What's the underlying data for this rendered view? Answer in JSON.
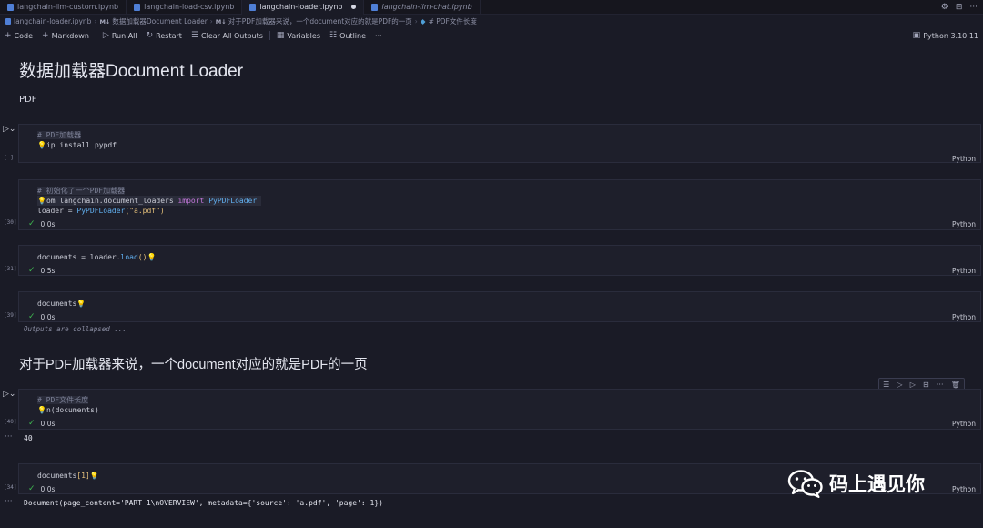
{
  "tabs": [
    {
      "label": "langchain-llm-custom.ipynb",
      "active": false
    },
    {
      "label": "langchain-load-csv.ipynb",
      "active": false
    },
    {
      "label": "langchain-loader.ipynb",
      "active": true
    },
    {
      "label": "langchain-llm-chat.ipynb",
      "active": false
    }
  ],
  "breadcrumb": {
    "file": "langchain-loader.ipynb",
    "md_tag": "M↓",
    "section1": "数据加载器Document Loader",
    "section2": "对于PDF加载器来说，一个document对应的就是PDF的一页",
    "section3": "# PDF文件长度"
  },
  "toolbar": {
    "code": "Code",
    "markdown": "Markdown",
    "run_all": "Run All",
    "restart": "Restart",
    "clear_outputs": "Clear All Outputs",
    "variables": "Variables",
    "outline": "Outline",
    "more": "···",
    "kernel": "Python 3.10.11"
  },
  "markdown": {
    "h1": "数据加载器Document Loader",
    "p": "PDF",
    "h2": "对于PDF加载器来说，一个document对应的就是PDF的一页"
  },
  "cells": {
    "c1": {
      "comment": "# PDF加载器",
      "line2": "ip install pypdf",
      "exec": "[ ]",
      "lang": "Python"
    },
    "c2": {
      "comment": "# 初始化了一个PDF加载器",
      "from_rest": "om langchain.document_loaders ",
      "import_kw": "import",
      "cls": "PyPDFLoader",
      "l3_var": "loader ",
      "l3_eq": "=",
      "l3_fn": "PyPDFLoader",
      "l3_str": "\"a.pdf\"",
      "exec": "[30]",
      "time": "0.0s",
      "lang": "Python"
    },
    "c3": {
      "var": "documents ",
      "eq": "=",
      "rest": " loader.",
      "fn": "load",
      "parens": "()",
      "exec": "[31]",
      "time": "0.5s",
      "lang": "Python"
    },
    "c4": {
      "var": "documents",
      "exec": "[39]",
      "time": "0.0s",
      "lang": "Python",
      "collapsed": "Outputs are collapsed ..."
    },
    "c5": {
      "comment": "# PDF文件长度",
      "rest": "n(documents)",
      "exec": "[40]",
      "time": "0.0s",
      "lang": "Python",
      "output": "40"
    },
    "c6": {
      "var": "documents",
      "idx": "[1]",
      "exec": "[34]",
      "time": "0.0s",
      "lang": "Python",
      "output": "Document(page_content='PART 1\\nOVERVIEW', metadata={'source': 'a.pdf', 'page': 1})"
    }
  },
  "watermark": {
    "text": "码上遇见你"
  }
}
